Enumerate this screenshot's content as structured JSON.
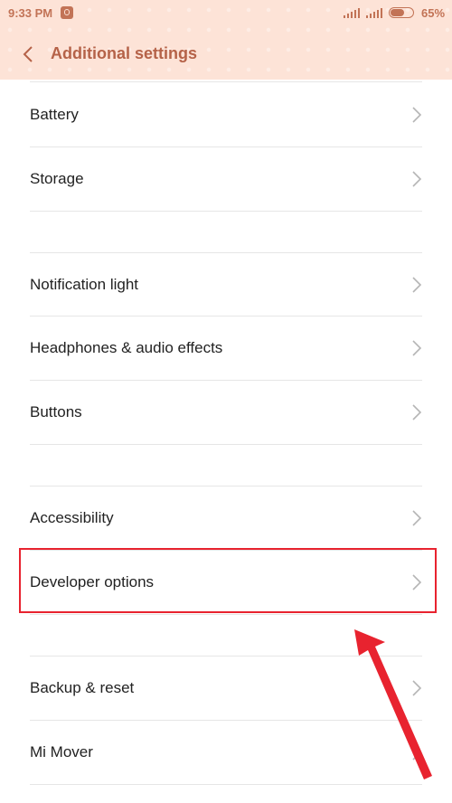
{
  "status_bar": {
    "time": "9:33 PM",
    "battery_percent": "65%",
    "battery_level": 0.65,
    "icons": [
      "notification-icon",
      "signal-icon",
      "signal-icon",
      "battery-icon"
    ]
  },
  "header": {
    "title": "Additional settings",
    "back_icon": "chevron-left-icon"
  },
  "settings": [
    {
      "label": "Battery"
    },
    {
      "label": "Storage"
    },
    {
      "label": "Notification light"
    },
    {
      "label": "Headphones & audio effects"
    },
    {
      "label": "Buttons"
    },
    {
      "label": "Accessibility"
    },
    {
      "label": "Developer options",
      "highlighted": true
    },
    {
      "label": "Backup & reset"
    },
    {
      "label": "Mi Mover"
    }
  ],
  "colors": {
    "header_bg": "#fde3d7",
    "header_text": "#b56248",
    "highlight": "#e8232f"
  }
}
